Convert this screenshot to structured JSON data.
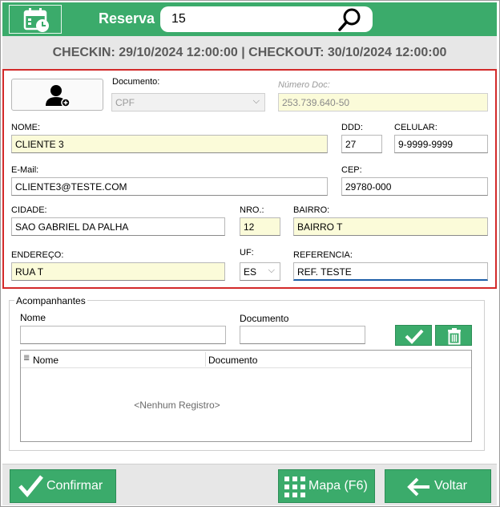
{
  "header": {
    "reserva_label": "Reserva",
    "reserva_value": "15",
    "checkin_line": "CHECKIN: 29/10/2024 12:00:00 | CHECKOUT: 30/10/2024 12:00:00"
  },
  "form": {
    "documento_label": "Documento:",
    "documento_value": "CPF",
    "numero_doc_label": "Número Doc:",
    "numero_doc_value": "253.739.640-50",
    "nome_label": "NOME:",
    "nome_value": "CLIENTE 3",
    "ddd_label": "DDD:",
    "ddd_value": "27",
    "celular_label": "CELULAR:",
    "celular_value": "9-9999-9999",
    "email_label": "E-Mail:",
    "email_value": "CLIENTE3@TESTE.COM",
    "cep_label": "CEP:",
    "cep_value": "29780-000",
    "cidade_label": "CIDADE:",
    "cidade_value": "SAO GABRIEL DA PALHA",
    "nro_label": "NRO.:",
    "nro_value": "12",
    "bairro_label": "BAIRRO:",
    "bairro_value": "BAIRRO T",
    "endereco_label": "ENDEREÇO:",
    "endereco_value": "RUA T",
    "uf_label": "UF:",
    "uf_value": "ES",
    "referencia_label": "REFERENCIA:",
    "referencia_value": "REF. TESTE"
  },
  "acompanhantes": {
    "title": "Acompanhantes",
    "nome_label": "Nome",
    "documento_label": "Documento",
    "grid_columns": [
      "Nome",
      "Documento"
    ],
    "empty_text": "<Nenhum Registro>"
  },
  "footer": {
    "confirmar": "Confirmar",
    "mapa": "Mapa (F6)",
    "voltar": "Voltar"
  },
  "colors": {
    "accent": "#3bab6b",
    "highlight_border": "#d32a2a",
    "field_yellow": "#fbfbd9"
  }
}
